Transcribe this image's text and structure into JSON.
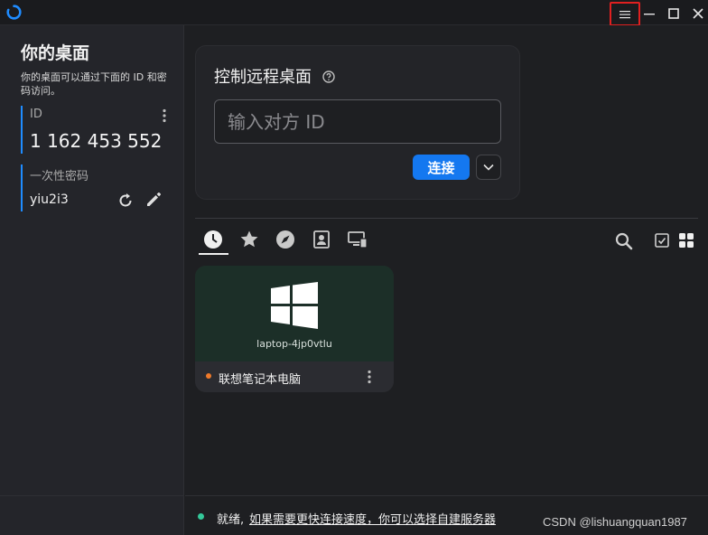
{
  "titlebar": {
    "icons": {
      "logo": "rustdesk-logo-icon",
      "menu": "hamburger-menu-icon",
      "minimize": "minimize-icon",
      "maximize": "maximize-icon",
      "close": "close-icon"
    },
    "highlight_color": "#e02020"
  },
  "left": {
    "title": "你的桌面",
    "description": "你的桌面可以通过下面的 ID 和密码访问。",
    "id_label": "ID",
    "id_value": "1 162 453 552",
    "password_label": "一次性密码",
    "password_value": "yiu2i3",
    "accent_color": "#1f8cff"
  },
  "control": {
    "title": "控制远程桌面",
    "input_placeholder": "输入对方 ID",
    "input_value": "",
    "connect_label": "连接",
    "accent_color": "#1478f0"
  },
  "tabs": [
    {
      "name": "recent-sessions",
      "icon": "clock-icon",
      "active": true
    },
    {
      "name": "favorites",
      "icon": "star-icon",
      "active": false
    },
    {
      "name": "discovered",
      "icon": "compass-icon",
      "active": false
    },
    {
      "name": "address-book",
      "icon": "contacts-icon",
      "active": false
    },
    {
      "name": "group",
      "icon": "devices-icon",
      "active": false
    }
  ],
  "peers": [
    {
      "hostname": "laptop-4jp0vtlu",
      "alias": "联想笔记本电脑",
      "os": "windows-icon",
      "status_color": "#f07a2a"
    }
  ],
  "status": {
    "text": "就绪,",
    "link": "如果需要更快连接速度，你可以选择自建服务器",
    "dot_color": "#34c99a"
  },
  "watermark": "CSDN @lishuangquan1987"
}
